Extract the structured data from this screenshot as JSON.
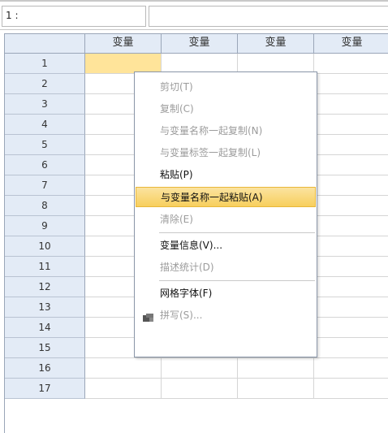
{
  "cell_ref": "1 :",
  "cell_value": "",
  "column_headers": [
    "变量",
    "变量",
    "变量",
    "变量"
  ],
  "row_numbers": [
    "1",
    "2",
    "3",
    "4",
    "5",
    "6",
    "7",
    "8",
    "9",
    "10",
    "11",
    "12",
    "13",
    "14",
    "15",
    "16",
    "17"
  ],
  "context_menu": {
    "items": [
      {
        "label": "剪切(T)",
        "enabled": false
      },
      {
        "label": "复制(C)",
        "enabled": false
      },
      {
        "label": "与变量名称一起复制(N)",
        "enabled": false
      },
      {
        "label": "与变量标签一起复制(L)",
        "enabled": false
      },
      {
        "label": "粘贴(P)",
        "enabled": true
      },
      {
        "label": "与变量名称一起粘贴(A)",
        "enabled": true,
        "highlighted": true
      },
      {
        "label": "清除(E)",
        "enabled": false
      },
      {
        "label": "变量信息(V)...",
        "enabled": true
      },
      {
        "label": "描述统计(D)",
        "enabled": false
      },
      {
        "label": "网格字体(F)",
        "enabled": true
      },
      {
        "label": "拼写(S)...",
        "enabled": false,
        "icon": "spell-check-icon"
      }
    ]
  },
  "colors": {
    "header_bg": "#e3ebf6",
    "selected_cell": "#ffe49a",
    "menu_highlight": "#f7cf5d"
  }
}
